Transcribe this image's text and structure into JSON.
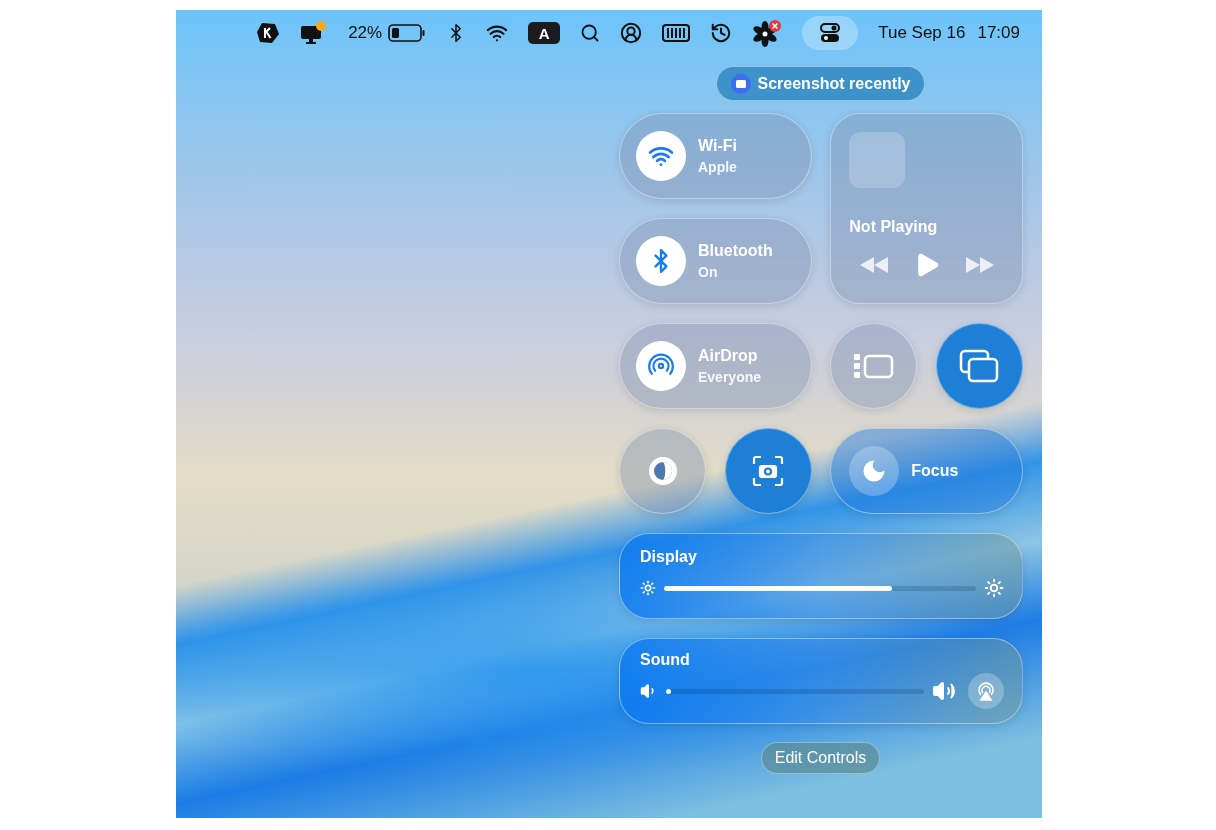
{
  "menu_bar": {
    "items": [
      {
        "kind": "logo",
        "selected": false
      },
      {
        "kind": "monitor",
        "selected": false
      },
      {
        "kind": "battery",
        "text": "22%",
        "selected": false
      },
      {
        "kind": "bluetooth",
        "selected": false
      },
      {
        "kind": "wifi",
        "selected": false
      },
      {
        "kind": "input",
        "text": "A",
        "selected": false
      },
      {
        "kind": "search",
        "selected": false
      },
      {
        "kind": "user",
        "selected": false
      },
      {
        "kind": "memory",
        "selected": false
      },
      {
        "kind": "history",
        "selected": false
      },
      {
        "kind": "fan",
        "selected": false
      },
      {
        "kind": "controls",
        "selected": true
      }
    ],
    "date": "Tue Sep 16",
    "time": "17:09"
  },
  "notice": {
    "label": "Screenshot recently"
  },
  "control_center": {
    "wifi": {
      "title": "Wi-Fi",
      "subtitle": "Apple",
      "on": true
    },
    "media": {
      "title": "Not Playing"
    },
    "bluetooth": {
      "title": "Bluetooth",
      "subtitle": "On",
      "on": true
    },
    "airdrop": {
      "title": "AirDrop",
      "subtitle": "Everyone",
      "on": true
    },
    "small_toggles": [
      {
        "kind": "stage",
        "on": false
      },
      {
        "kind": "mirror",
        "on": true
      },
      {
        "kind": "contrast",
        "on": false
      },
      {
        "kind": "screenshot",
        "on": true
      }
    ],
    "focus": {
      "title": "Focus",
      "on": false
    },
    "display": {
      "title": "Display",
      "level": 0.73
    },
    "sound": {
      "title": "Sound",
      "level": 0.02
    },
    "edit_button": "Edit Controls"
  }
}
